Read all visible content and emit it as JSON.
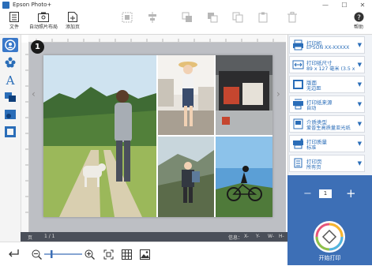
{
  "window": {
    "title": "Epson Photo+",
    "min_glyph": "—",
    "max_glyph": "☐",
    "close_glyph": "✕"
  },
  "toolbar": {
    "file_label": "文件",
    "auto_layout_label": "自动照片布局",
    "add_page_label": "添加页",
    "help_label": "帮助"
  },
  "canvas": {
    "prev_arrow": "‹",
    "next_arrow": "›"
  },
  "status": {
    "page_label": "页",
    "page_value": "1 / 1",
    "info_label": "信息：",
    "x_label": "X-",
    "y_label": "Y-",
    "w_label": "W-",
    "h_label": "H-"
  },
  "settings": [
    {
      "title": "打印机",
      "value": "EPSON XX-XXXXX",
      "icon": "printer-icon"
    },
    {
      "title": "打印纸尺寸",
      "value": "89 x 127 毫米 (3.5 x 5...",
      "icon": "paper-size-icon"
    },
    {
      "title": "版面",
      "value": "无边距",
      "icon": "layout-icon"
    },
    {
      "title": "打印纸来源",
      "value": "自动",
      "icon": "paper-source-icon"
    },
    {
      "title": "介质类型",
      "value": "爱普生高质量亚光纸",
      "icon": "media-type-icon"
    },
    {
      "title": "打印质量",
      "value": "标准",
      "icon": "print-quality-icon"
    },
    {
      "title": "打印页",
      "value": "所有页",
      "icon": "print-pages-icon"
    }
  ],
  "print": {
    "copies": "1",
    "minus": "−",
    "plus": "+",
    "print_label": "开始打印"
  },
  "callout": {
    "number": "1"
  },
  "colors": {
    "accent": "#3d6fb6",
    "link": "#2a6db8",
    "status_bg": "#4a4f59",
    "canvas_bg": "#bdbfc4"
  }
}
